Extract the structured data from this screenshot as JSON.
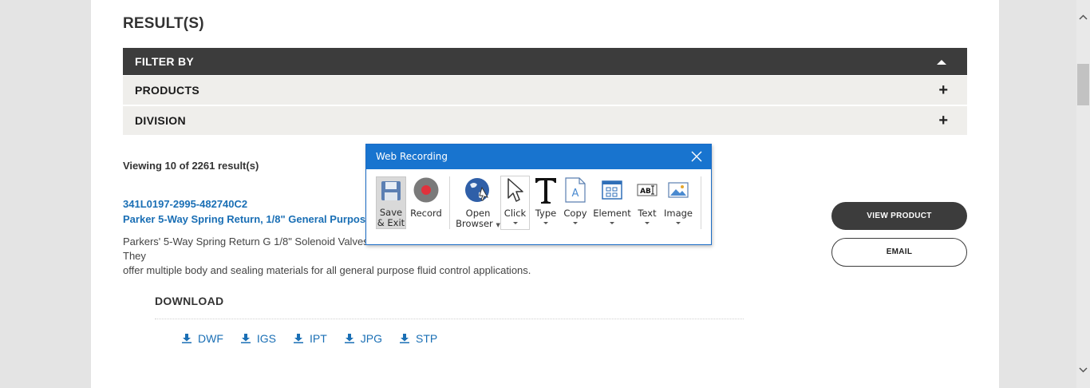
{
  "page": {
    "results_title": "RESULT(S)",
    "filter": {
      "header": "FILTER BY",
      "rows": [
        "PRODUCTS",
        "DIVISION"
      ],
      "expand_symbol": "+"
    },
    "viewing": "Viewing 10 of 2261 result(s)",
    "product": {
      "part_number": "341L0197-2995-482740C2",
      "title": "Parker 5-Way Spring Return, 1/8\" General Purpose S",
      "description_left": "Parkers' 5-Way Spring Return G 1/8\" Solenoid Valves",
      "description_right": "They",
      "description_line2": "offer multiple body and sealing materials for all general purpose fluid control applications.",
      "view_button": "VIEW PRODUCT",
      "email_button": "EMAIL"
    },
    "download": {
      "title": "DOWNLOAD",
      "links": [
        "DWF",
        "IGS",
        "IPT",
        "JPG",
        "STP"
      ]
    }
  },
  "dialog": {
    "title": "Web Recording",
    "tools": {
      "save": [
        "Save",
        "& Exit"
      ],
      "record": "Record",
      "open_browser": [
        "Open",
        "Browser"
      ],
      "click": "Click",
      "type": "Type",
      "copy": "Copy",
      "element": "Element",
      "text": "Text",
      "image": "Image"
    }
  },
  "colors": {
    "link_blue": "#1a6fb5",
    "dark_bar": "#3c3c3c",
    "dialog_blue": "#1874cf",
    "record_red": "#e0323c"
  }
}
